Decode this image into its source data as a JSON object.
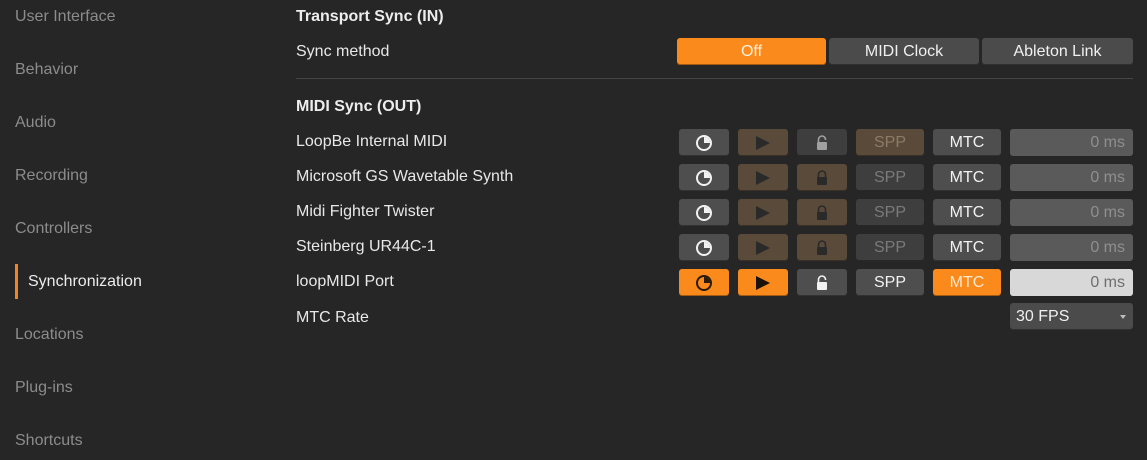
{
  "sidebar": {
    "items": [
      {
        "label": "User Interface"
      },
      {
        "label": "Behavior"
      },
      {
        "label": "Audio"
      },
      {
        "label": "Recording"
      },
      {
        "label": "Controllers"
      },
      {
        "label": "Synchronization",
        "active": true
      },
      {
        "label": "Locations"
      },
      {
        "label": "Plug-ins"
      },
      {
        "label": "Shortcuts"
      }
    ]
  },
  "transport_sync": {
    "title": "Transport Sync (IN)",
    "sync_method_label": "Sync method",
    "options": [
      "Off",
      "MIDI Clock",
      "Ableton Link"
    ],
    "selected": "Off"
  },
  "midi_sync": {
    "title": "MIDI Sync (OUT)",
    "spp_label": "SPP",
    "mtc_label": "MTC",
    "devices": [
      {
        "name": "LoopBe Internal MIDI",
        "offset": "0 ms"
      },
      {
        "name": "Microsoft GS Wavetable Synth",
        "offset": "0 ms"
      },
      {
        "name": "Midi Fighter Twister",
        "offset": "0 ms"
      },
      {
        "name": "Steinberg UR44C-1",
        "offset": "0 ms"
      },
      {
        "name": "loopMIDI Port",
        "offset": "0 ms"
      }
    ],
    "mtc_rate_label": "MTC Rate",
    "mtc_rate_value": "30 FPS"
  },
  "colors": {
    "accent": "#f98a1b",
    "background": "#262626",
    "button": "#4b4b4b",
    "button_brown": "#5a4a3a"
  },
  "icons": {
    "clock": "clock-icon",
    "play": "play-icon",
    "lock": "lock-icon",
    "dropdown": "chevron-down-icon"
  }
}
